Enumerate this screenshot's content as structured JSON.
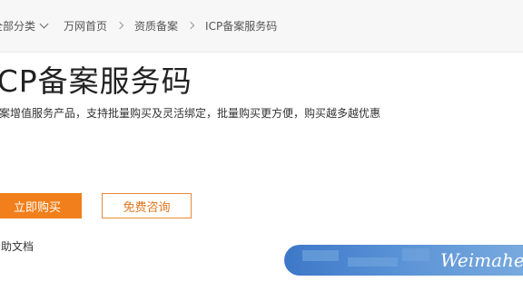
{
  "breadcrumb": {
    "category_label": "全部分类",
    "items": [
      "万网首页",
      "资质备案",
      "ICP备案服务码"
    ]
  },
  "hero": {
    "title": "ICP备案服务码",
    "description": "备案增值服务产品，支持批量购买及灵活绑定，批量购买更方便，购买越多越优惠",
    "buy_button": "立即购买",
    "consult_button": "免费咨询",
    "help_link": "帮助文档"
  },
  "watermark": {
    "text": "Weimahe.cn"
  },
  "colors": {
    "accent": "#f17f1b",
    "accent_border": "#e8883a",
    "watermark_blue": "#3d78c8"
  }
}
